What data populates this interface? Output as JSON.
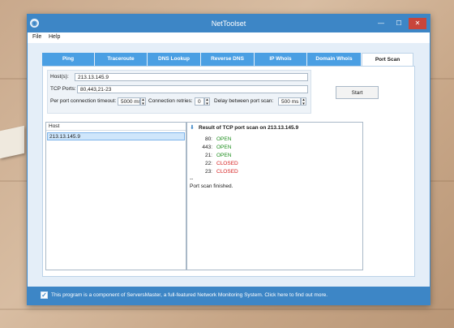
{
  "window": {
    "title": "NetToolset",
    "controls": {
      "minimize": "—",
      "maximize": "☐",
      "close": "✕"
    }
  },
  "menu": {
    "file": "File",
    "help": "Help"
  },
  "tabs": [
    {
      "label": "Ping",
      "active": false
    },
    {
      "label": "Traceroute",
      "active": false
    },
    {
      "label": "DNS Lookup",
      "active": false
    },
    {
      "label": "Reverse DNS",
      "active": false
    },
    {
      "label": "IP Whois",
      "active": false
    },
    {
      "label": "Domain Whois",
      "active": false
    },
    {
      "label": "Port Scan",
      "active": true
    }
  ],
  "form": {
    "hosts_label": "Host(s):",
    "hosts_value": "213.13.145.9",
    "ports_label": "TCP Ports:",
    "ports_value": "80,443,21-23",
    "timeout_label": "Per port connection timeout:",
    "timeout_value": "5000 ms",
    "retries_label": "Connection retries:",
    "retries_value": "0",
    "delay_label": "Delay between port scan:",
    "delay_value": "500 ms"
  },
  "start_button": "Start",
  "host_list": {
    "header": "Host",
    "rows": [
      "213.13.145.9"
    ]
  },
  "result": {
    "title": "Result of TCP port scan on 213.13.145.9",
    "ports": [
      {
        "port": "80:",
        "status": "OPEN"
      },
      {
        "port": "443:",
        "status": "OPEN"
      },
      {
        "port": "21:",
        "status": "OPEN"
      },
      {
        "port": "22:",
        "status": "CLOSED"
      },
      {
        "port": "23:",
        "status": "CLOSED"
      }
    ],
    "separator": "--",
    "finished": "Port scan finished."
  },
  "footer": {
    "checked": true,
    "text": "This program is a component of ServersMaster, a full-featured Network Monitoring System. Click here to find out more."
  },
  "colors": {
    "accent": "#3d86c6",
    "tab": "#4a9fe3",
    "open": "#1e8e1e",
    "closed": "#d62121"
  }
}
